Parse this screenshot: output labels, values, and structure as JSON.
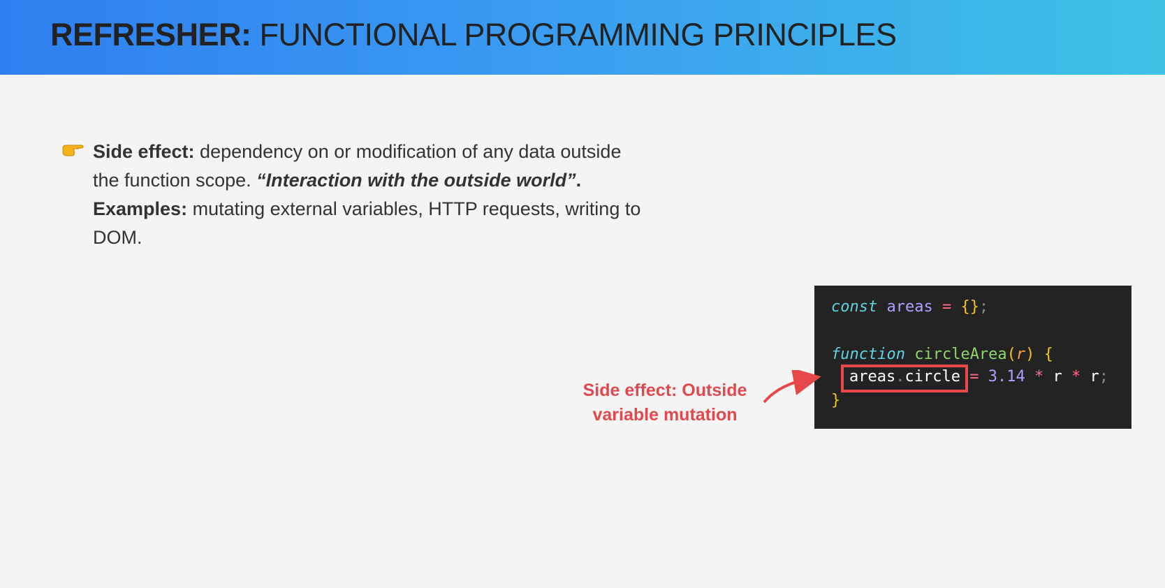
{
  "header": {
    "title_bold": "REFRESHER:",
    "title_rest": " FUNCTIONAL PROGRAMMING PRINCIPLES"
  },
  "bullet": {
    "icon": "pointing-hand-icon",
    "term": "Side effect:",
    "text1": " dependency on or modification of any data outside the function scope. ",
    "quote": "“Interaction with the outside world”",
    "text2": ". ",
    "examples_label": "Examples:",
    "text3": " mutating external variables, HTTP requests, writing to DOM."
  },
  "code": {
    "line1": {
      "kw": "const",
      "var": "areas",
      "op": "=",
      "br": "{}",
      "semi": ";"
    },
    "line2": {
      "kw": "function",
      "fn": "circleArea",
      "lp": "(",
      "param": "r",
      "rp": ")",
      "br": "{"
    },
    "line3": {
      "obj": "areas",
      "dot": ".",
      "prop": "circle",
      "op": "=",
      "num": "3.14",
      "mul1": "*",
      "r1": "r",
      "mul2": "*",
      "r2": "r",
      "semi": ";"
    },
    "line4": {
      "br": "}"
    }
  },
  "annotation": {
    "text": "Side effect: Outside variable mutation",
    "color": "#e04a4f"
  },
  "colors": {
    "header_start": "#2f7ff0",
    "header_end": "#3ec2e6",
    "code_bg": "#232323",
    "highlight": "#e8474b"
  }
}
